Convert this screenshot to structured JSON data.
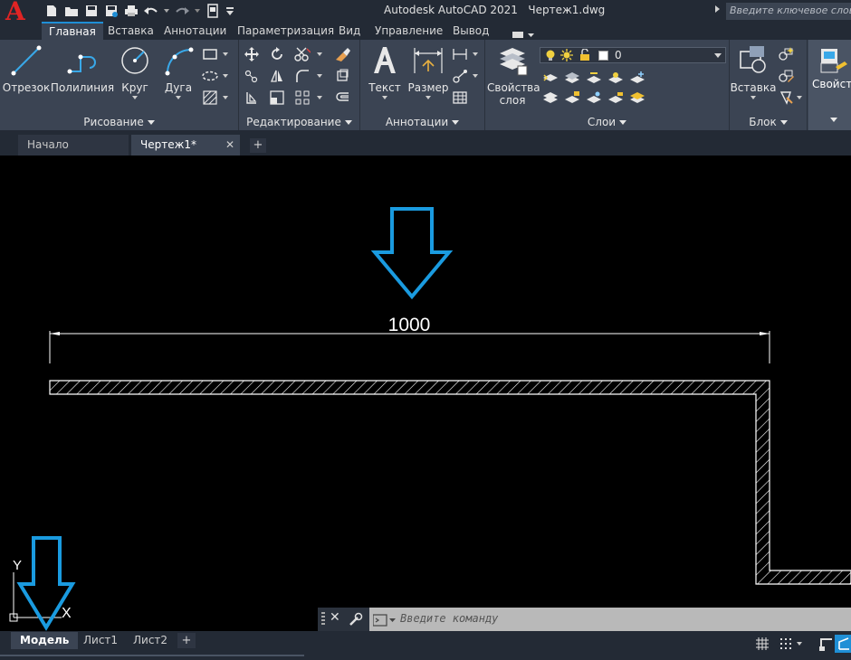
{
  "app": {
    "logo": "A",
    "title": "Autodesk AutoCAD 2021",
    "document": "Чертеж1.dwg",
    "search_placeholder": "Введите ключевое слово/фразу"
  },
  "ribbon_tabs": [
    "Главная",
    "Вставка",
    "Аннотации",
    "Параметризация",
    "Вид",
    "Управление",
    "Вывод"
  ],
  "panels": {
    "draw": {
      "title": "Рисование",
      "line": "Отрезок",
      "polyline": "Полилиния",
      "circle": "Круг",
      "arc": "Дуга"
    },
    "modify": {
      "title": "Редактирование"
    },
    "annotation": {
      "title": "Аннотации",
      "text": "Текст",
      "dimension": "Размер"
    },
    "layers": {
      "title": "Слои",
      "layer_properties": "Свойства слоя",
      "current_layer": "0"
    },
    "block": {
      "title": "Блок",
      "insert": "Вставка"
    },
    "properties": {
      "label": "Свойства"
    }
  },
  "doc_tabs": [
    {
      "label": "Начало"
    },
    {
      "label": "Чертеж1*"
    }
  ],
  "drawing": {
    "dimension_text": "1000",
    "ucs_y": "Y",
    "ucs_x": "X"
  },
  "command_line": {
    "placeholder": "Введите команду"
  },
  "layout_tabs": [
    "Модель",
    "Лист1",
    "Лист2"
  ],
  "colors": {
    "accent_blue": "#1f8fd6",
    "arrow_blue": "#1a9be0",
    "logo_red": "#e02424",
    "drawing_bg": "#000000"
  }
}
